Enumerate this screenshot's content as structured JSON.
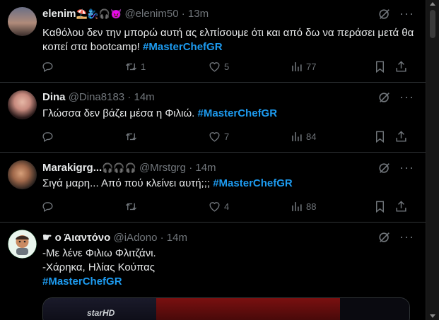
{
  "tweets": [
    {
      "name": "elenim",
      "emoji": "⛱️🧞‍♀️🎧😈",
      "handle": "@elenim50",
      "sep": "·",
      "time": "13m",
      "text": "Καθόλου δεν την μπορώ αυτή ας ελπίσουμε ότι και από δω να περάσει μετά θα κοπεί στα bootcamp! ",
      "hashtag": "#MasterChefGR",
      "replies": "",
      "retweets": "1",
      "likes": "5",
      "views": "77"
    },
    {
      "name": "Dina",
      "emoji": "",
      "handle": "@Dina8183",
      "sep": "·",
      "time": "14m",
      "text": "Γλώσσα δεν βάζει μέσα η Φιλιώ. ",
      "hashtag": "#MasterChefGR",
      "replies": "",
      "retweets": "",
      "likes": "7",
      "views": "84"
    },
    {
      "name": "Marakigrg...",
      "emoji": "🎧🎧🎧",
      "handle": "@Mrstgrg",
      "sep": "·",
      "time": "14m",
      "text": "Σιγά μαρη... Από πού κλείνει αυτή;;; ",
      "hashtag": "#MasterChefGR",
      "replies": "",
      "retweets": "",
      "likes": "4",
      "views": "88"
    },
    {
      "name": "☛ ο Άιαντόνο",
      "emoji": "",
      "handle": "@iAdono",
      "sep": "·",
      "time": "14m",
      "line1": "-Με λένε Φιλιω Φλιτζάνι.",
      "line2": "-Χάρηκα, Ηλίας Κούπας",
      "hashtag": "#MasterChefGR",
      "media_logo": "starHD"
    }
  ],
  "colors": {
    "accent": "#1d9bf0",
    "muted": "#71767b",
    "divider": "#2f3336"
  },
  "icons": [
    "reply-icon",
    "retweet-icon",
    "like-icon",
    "views-icon",
    "bookmark-icon",
    "share-icon",
    "grok-icon",
    "more-icon"
  ]
}
